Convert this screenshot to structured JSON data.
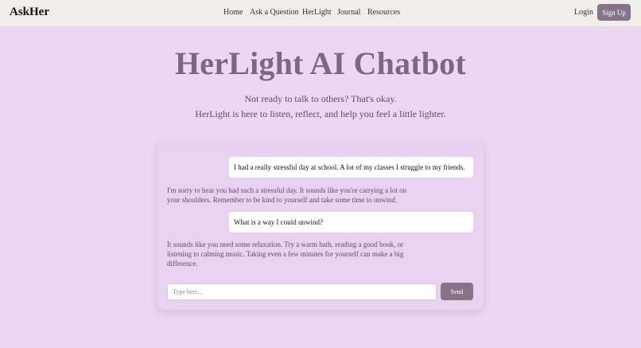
{
  "nav": {
    "brand": "AskHer",
    "links": [
      "Home",
      "Ask a Question",
      "HerLight",
      "Journal",
      "Resources"
    ],
    "login": "Login",
    "signup": "Sign Up"
  },
  "hero": {
    "title": "HerLight AI Chatbot",
    "subtitle_line1": "Not ready to talk to others? That's okay.",
    "subtitle_line2": "HerLight is here to listen, reflect, and help you feel a little lighter."
  },
  "chat": {
    "messages": [
      {
        "role": "user",
        "text": "I had a really stressful day at school. A lot of my classes I struggle to my friends."
      },
      {
        "role": "bot",
        "text": "I'm sorry to hear you had such a stressful day. It sounds like you're carrying a lot on your shoulders. Remember to be kind to yourself and take some time to unwind."
      },
      {
        "role": "user",
        "text": "What is a way I could unwind?"
      },
      {
        "role": "bot",
        "text": "It sounds like you need some relaxation. Try a warm bath, reading a good book, or listening to calming music. Taking even a few minutes for yourself can make a big difference."
      }
    ],
    "input_placeholder": "Type here...",
    "input_value": "",
    "send_label": "Send"
  },
  "colors": {
    "background": "#ecd6f3",
    "navbar": "#f1eee9",
    "accent": "#86738a",
    "title": "#7c6680",
    "card": "#e8d1f1"
  }
}
